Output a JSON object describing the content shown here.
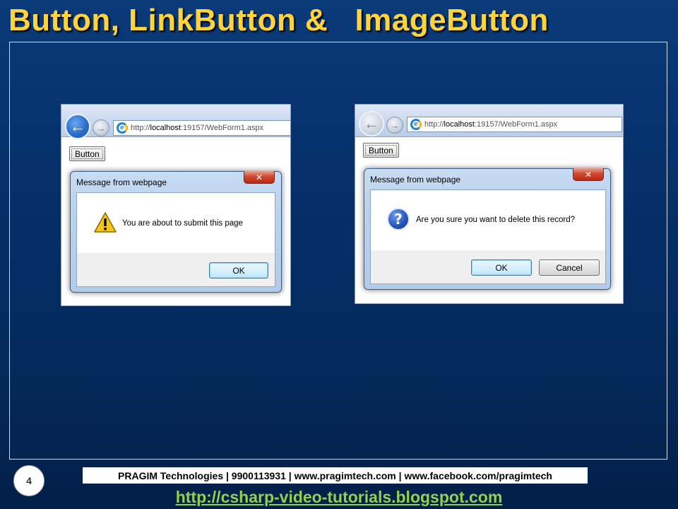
{
  "slide": {
    "title": "Button, LinkButton &   ImageButton",
    "number": "4"
  },
  "browsers": [
    {
      "address": {
        "prefix": "http://",
        "host": "localhost",
        "rest": ":19157/WebForm1.aspx"
      },
      "page_button_label": "Button",
      "back_icon": "back-arrow-icon",
      "dialog": {
        "title": "Message from webpage",
        "close_label": "✕",
        "message": "You are about to submit this page",
        "icon": "warning-icon",
        "ok_label": "OK"
      }
    },
    {
      "address": {
        "prefix": "http://",
        "host": "localhost",
        "rest": ":19157/WebForm1.aspx"
      },
      "page_button_label": "Button",
      "back_icon": "back-arrow-icon",
      "dialog": {
        "title": "Message from webpage",
        "close_label": "✕",
        "message": "Are you sure you want to delete this record?",
        "icon": "question-icon",
        "ok_label": "OK",
        "cancel_label": "Cancel"
      }
    }
  ],
  "footer": {
    "info": "PRAGIM Technologies | 9900113931 | www.pragimtech.com | www.facebook.com/pragimtech",
    "link": "http://csharp-video-tutorials.blogspot.com"
  },
  "colors": {
    "title": "#ffd43b",
    "link": "#92d050",
    "background": "#05306a"
  }
}
